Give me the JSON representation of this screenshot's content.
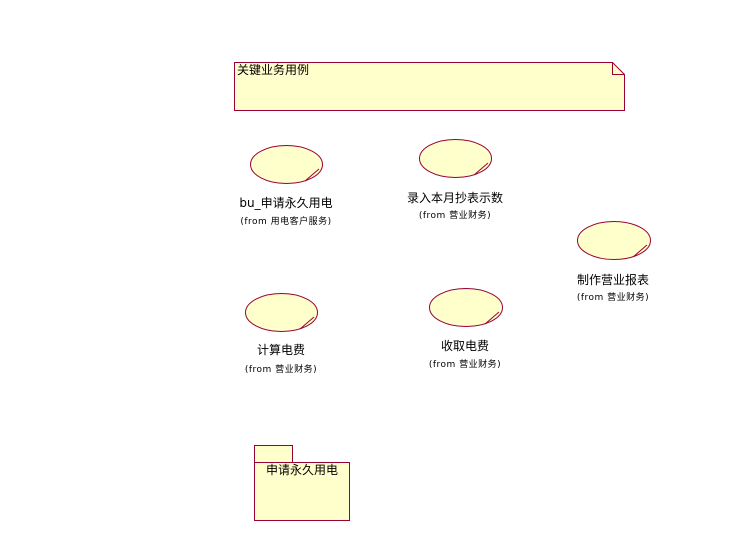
{
  "colors": {
    "fill": "#ffffcc",
    "stroke": "#990033",
    "text": "#000000"
  },
  "note": {
    "text": "关键业务用例"
  },
  "use_cases": [
    {
      "name": "bu_申请永久用电",
      "from": "(from 用电客户服务)"
    },
    {
      "name": "录入本月抄表示数",
      "from": "(from 营业财务)"
    },
    {
      "name": "制作营业报表",
      "from": "(from 营业财务)"
    },
    {
      "name": "计算电费",
      "from": "(from 营业财务)"
    },
    {
      "name": "收取电费",
      "from": "(from 营业财务)"
    }
  ],
  "package": {
    "name": "申请永久用电"
  }
}
